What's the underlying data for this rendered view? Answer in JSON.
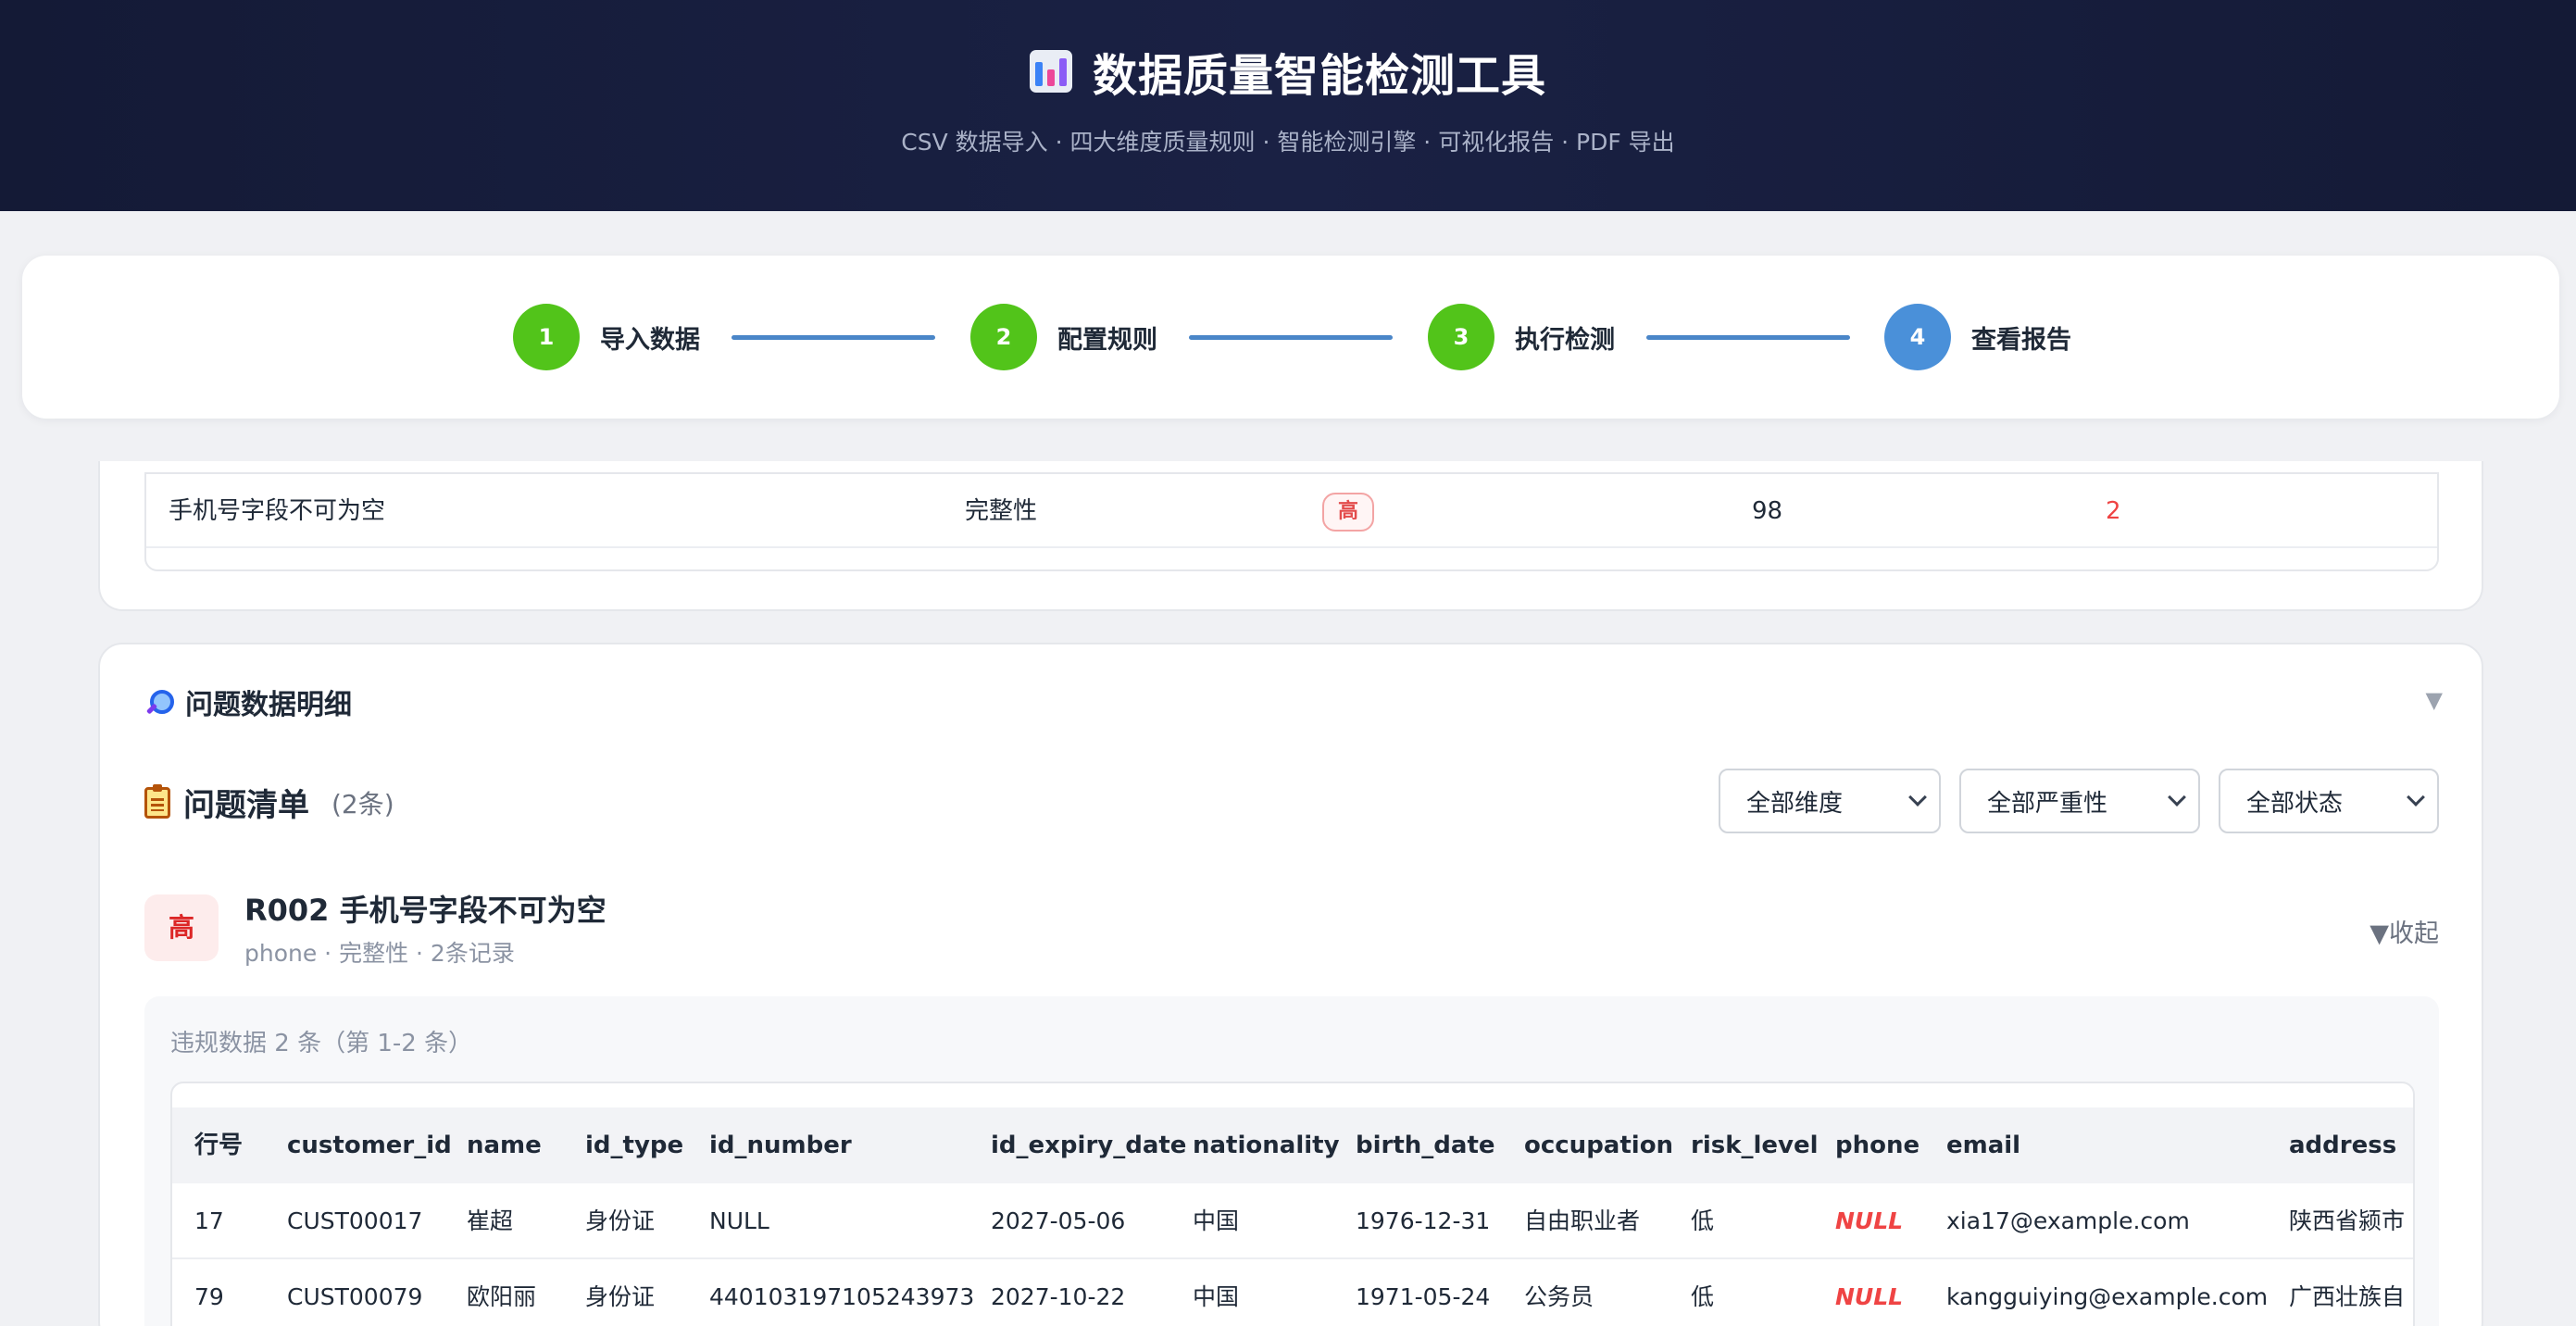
{
  "header": {
    "title": "数据质量智能检测工具",
    "subtitle": "CSV 数据导入 · 四大维度质量规则 · 智能检测引擎 · 可视化报告 · PDF 导出",
    "logo_icon": "bar-chart-icon"
  },
  "steps": [
    {
      "number": "1",
      "label": "导入数据",
      "state": "done"
    },
    {
      "number": "2",
      "label": "配置规则",
      "state": "done"
    },
    {
      "number": "3",
      "label": "执行检测",
      "state": "done"
    },
    {
      "number": "4",
      "label": "查看报告",
      "state": "active"
    }
  ],
  "rules_table": {
    "rows": [
      {
        "rule": "手机号字段不可为空",
        "dimension": "完整性",
        "severity": "高",
        "passed": "98",
        "failed": "2"
      }
    ]
  },
  "details": {
    "title": "问题数据明细",
    "title_icon": "magnifier-icon",
    "collapse_icon": "caret-down-icon",
    "list_title": "问题清单",
    "list_icon": "clipboard-icon",
    "list_count": "(2条)",
    "filters": [
      {
        "selected": "全部维度"
      },
      {
        "selected": "全部严重性"
      },
      {
        "selected": "全部状态"
      }
    ]
  },
  "issue": {
    "severity": "高",
    "name": "R002 手机号字段不可为空",
    "meta": "phone · 完整性 · 2条记录",
    "toggle": "▼收起",
    "caption": "违规数据 2 条（第 1-2 条）",
    "columns": [
      "行号",
      "customer_id",
      "name",
      "id_type",
      "id_number",
      "id_expiry_date",
      "nationality",
      "birth_date",
      "occupation",
      "risk_level",
      "phone",
      "email",
      "address"
    ],
    "rows": [
      [
        "17",
        "CUST00017",
        "崔超",
        "身份证",
        "NULL",
        "2027-05-06",
        "中国",
        "1976-12-31",
        "自由职业者",
        "低",
        "NULL",
        "xia17@example.com",
        "陕西省颍市"
      ],
      [
        "79",
        "CUST00079",
        "欧阳丽",
        "身份证",
        "440103197105243973",
        "2027-10-22",
        "中国",
        "1971-05-24",
        "公务员",
        "低",
        "NULL",
        "kangguiying@example.com",
        "广西壮族自"
      ]
    ]
  },
  "colors": {
    "header_bg": "#141a36",
    "step_done": "#52c41a",
    "step_active": "#4a90d9",
    "severity_high": "#dc2626",
    "null_value": "#ef4444"
  }
}
